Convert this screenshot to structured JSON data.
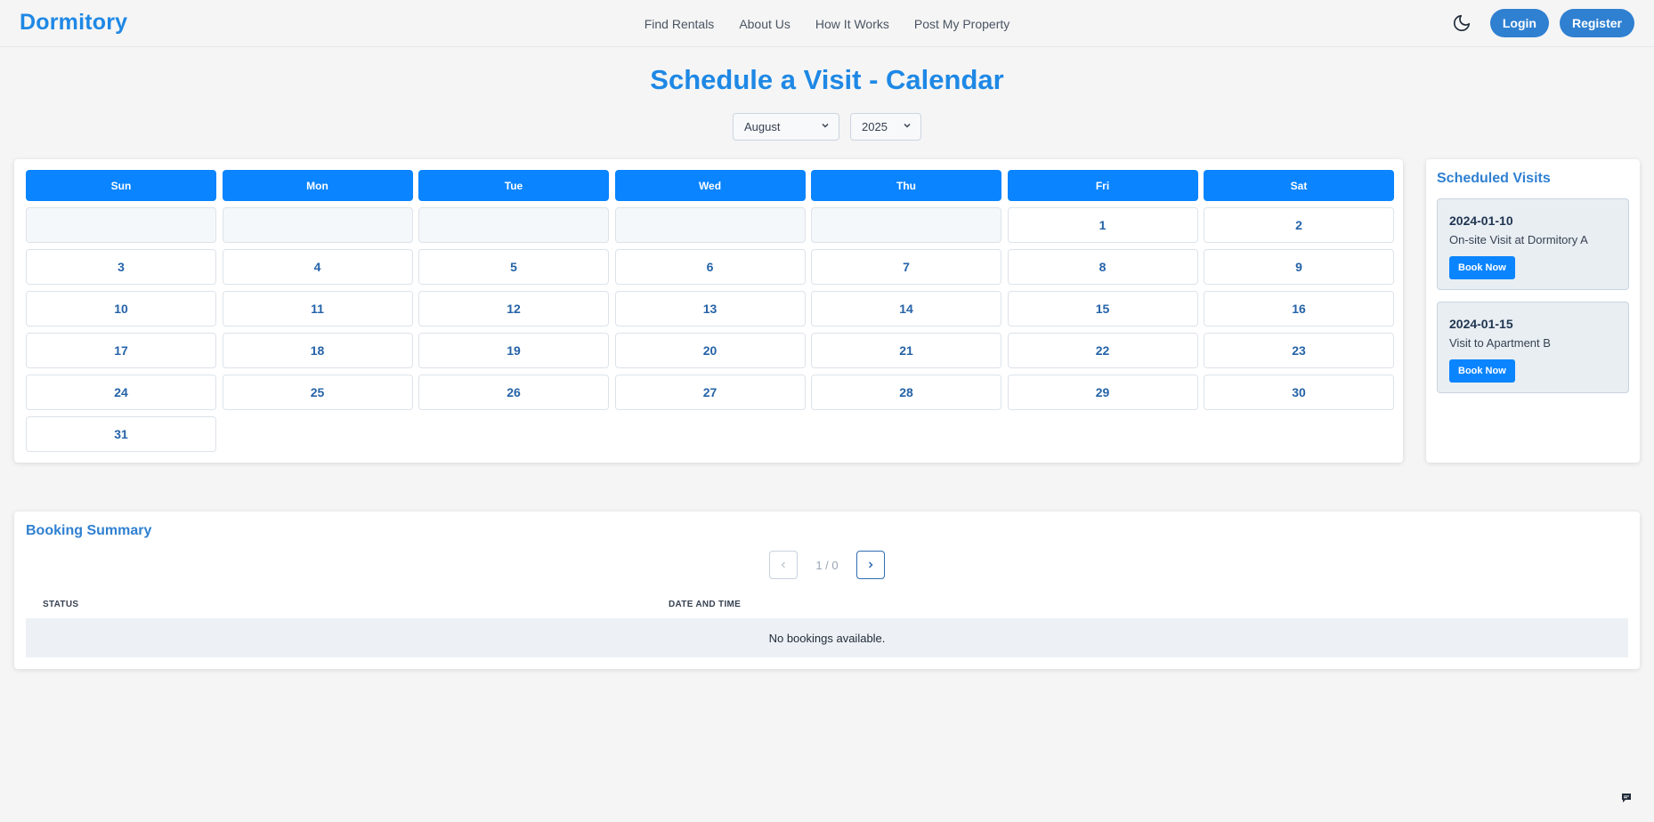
{
  "nav": {
    "brand": "Dormitory",
    "links": [
      "Find Rentals",
      "About Us",
      "How It Works",
      "Post My Property"
    ],
    "login": "Login",
    "register": "Register",
    "theme_icon": "moon-icon"
  },
  "page_title": "Schedule a Visit - Calendar",
  "month_select": {
    "value": "August"
  },
  "year_select": {
    "value": "2025"
  },
  "calendar": {
    "weekdays": [
      "Sun",
      "Mon",
      "Tue",
      "Wed",
      "Thu",
      "Fri",
      "Sat"
    ],
    "leading_blanks": 5,
    "days": [
      "1",
      "2",
      "3",
      "4",
      "5",
      "6",
      "7",
      "8",
      "9",
      "10",
      "11",
      "12",
      "13",
      "14",
      "15",
      "16",
      "17",
      "18",
      "19",
      "20",
      "21",
      "22",
      "23",
      "24",
      "25",
      "26",
      "27",
      "28",
      "29",
      "30",
      "31"
    ]
  },
  "visits": {
    "title": "Scheduled Visits",
    "items": [
      {
        "date": "2024-01-10",
        "description": "On-site Visit at Dormitory A",
        "button": "Book Now"
      },
      {
        "date": "2024-01-15",
        "description": "Visit to Apartment B",
        "button": "Book Now"
      }
    ]
  },
  "summary": {
    "title": "Booking Summary",
    "pager": {
      "text": "1 / 0",
      "prev_icon": "chevron-left-icon",
      "next_icon": "chevron-right-icon"
    },
    "columns": [
      "STATUS",
      "DATE AND TIME"
    ],
    "empty": "No bookings available."
  },
  "colors": {
    "accent": "#1e88e5",
    "header_blue": "#0a84ff",
    "button_blue": "#2f80d1"
  }
}
